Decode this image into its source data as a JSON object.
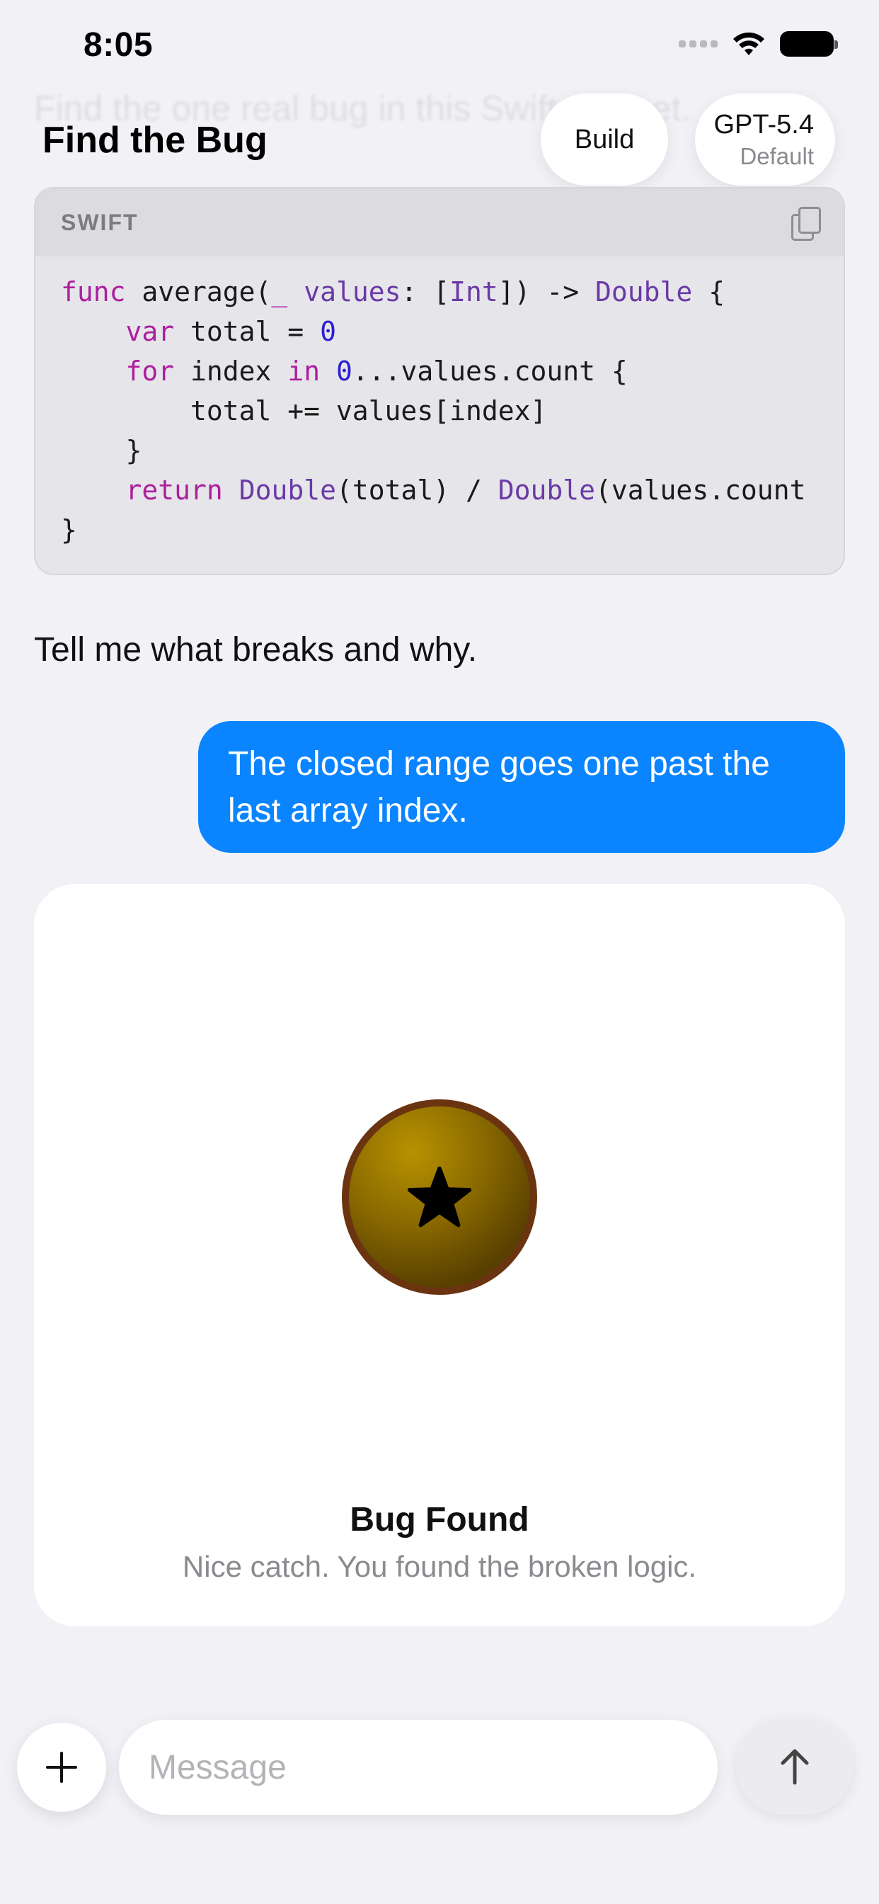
{
  "status_bar": {
    "time": "8:05"
  },
  "header": {
    "ghost_text": "Find the one real bug in this Swift snippet.",
    "title": "Find the Bug",
    "build_label": "Build",
    "model_name": "GPT-5.4",
    "model_variant": "Default"
  },
  "code_block": {
    "language": "SWIFT",
    "lines": [
      "func average(_ values: [Int]) -> Double {",
      "    var total = 0",
      "    for index in 0...values.count {",
      "        total += values[index]",
      "    }",
      "    return Double(total) / Double(values.count",
      "}"
    ]
  },
  "prompt_text": "Tell me what breaks and why.",
  "user_message": "The closed range goes one past the last array index.",
  "result": {
    "title": "Bug Found",
    "subtitle": "Nice catch. You found the broken logic."
  },
  "composer": {
    "placeholder": "Message"
  },
  "colors": {
    "background": "#f2f1f6",
    "user_bubble": "#0a84ff",
    "keyword": "#ad1f9e",
    "type": "#6a3aa6",
    "number": "#2c1fd0",
    "badge_ring": "#6b3410"
  }
}
